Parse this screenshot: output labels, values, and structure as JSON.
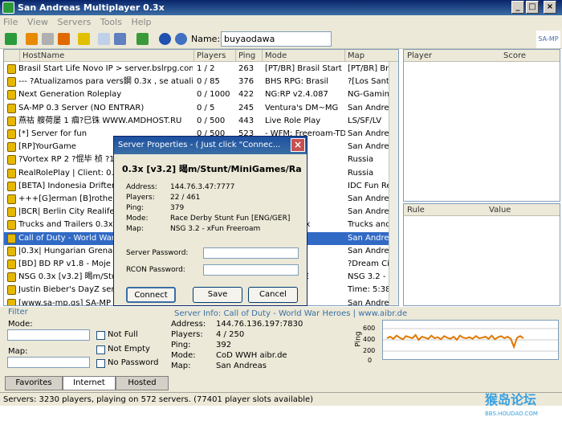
{
  "window": {
    "title": "San Andreas Multiplayer 0.3x",
    "min_label": "_",
    "max_label": "□",
    "close_label": "×"
  },
  "menu": [
    "File",
    "View",
    "Servers",
    "Tools",
    "Help"
  ],
  "toolbar": {
    "name_label": "Name:",
    "name_value": "buyaodawa"
  },
  "list_headers": [
    "HostName",
    "Players",
    "Ping",
    "Mode",
    "Map"
  ],
  "servers": [
    {
      "host": "Brasil Start Life Novo IP > server.bslrpg.com:7777",
      "players": "1 / 2",
      "ping": "263",
      "mode": "[PT/BR] Brasil Start Life | v",
      "map": "[PT/BR] Bra"
    },
    {
      "host": "--- ?Atualizamos para vers鋼 0.3x , se atualize!",
      "players": "0 / 85",
      "ping": "376",
      "mode": "BHS RPG: Brasil",
      "map": "?[Los Santo"
    },
    {
      "host": "Next Generation Roleplay",
      "players": "0 / 1000",
      "ping": "422",
      "mode": "NG:RP v2.4.087",
      "map": "NG-Gaming."
    },
    {
      "host": "SA-MP 0.3 Server (NO ENTRAR)",
      "players": "0 / 5",
      "ping": "245",
      "mode": "Ventura's DM~MG",
      "map": "San Andreas"
    },
    {
      "host": "燕祜 艘荷屡 1 痼?巳铢  WWW.AMDHOST.RU",
      "players": "0 / 500",
      "ping": "443",
      "mode": "Live Role Play",
      "map": "LS/SF/LV"
    },
    {
      "host": "[*] Server for fun",
      "players": "0 / 500",
      "ping": "523",
      "mode": "- WFM: Freeroam-TDM-S",
      "map": "San Andreas"
    },
    {
      "host": "[RP]YourGame",
      "players": "",
      "ping": "",
      "mode": "**********",
      "map": "San Andreas"
    },
    {
      "host": "?Vortex RP 2 ?惃毕   桢 ?1",
      "players": "",
      "ping": "",
      "mode": "",
      "map": "Russia"
    },
    {
      "host": "RealRolePlay | Client: 0.3x",
      "players": "",
      "ping": "",
      "mode": "",
      "map": "Russia"
    },
    {
      "host": "[BETA] Indonesia Drifter C",
      "players": "",
      "ping": "",
      "mode": "World!",
      "map": "IDC Fun Rele"
    },
    {
      "host": "+++[G]erman [B]rother[H]",
      "players": "",
      "ping": "",
      "mode": "",
      "map": "San Andreas"
    },
    {
      "host": "|BCR| Berlin City Realife |G",
      "players": "",
      "ping": "",
      "mode": "fe",
      "map": "San Andreas"
    },
    {
      "host": "Trucks and Trailers 0.3x (c",
      "players": "",
      "ping": "",
      "mode": "railers 0.3x",
      "map": "Trucks and T"
    },
    {
      "host": "Call of Duty - World War He",
      "players": "",
      "ping": "",
      "mode": "r.de",
      "map": "San Andreas"
    },
    {
      "host": "|0.3x| Hungarian Grenade W",
      "players": "",
      "ping": "",
      "mode": "e War",
      "map": "San Andreas"
    },
    {
      "host": "[BD] BD RP v1.8 - Moje kuc",
      "players": "",
      "ping": "",
      "mode": "",
      "map": "?Dream City"
    },
    {
      "host": "NSG 0.3x [v3.2]    暍m/Stu",
      "players": "",
      "ping": "",
      "mode": "tunt Fun [E",
      "map": "NSG 3.2 - xf"
    },
    {
      "host": "Justin Bieber's DayZ server",
      "players": "",
      "ping": "",
      "mode": "?v4.4",
      "map": "Time: 5:38"
    },
    {
      "host": "[www.sa-mp.gs] SA-MP 0.3",
      "players": "",
      "ping": "",
      "mode": "Batch",
      "map": "San Andreas"
    }
  ],
  "player_headers": [
    "Player",
    "Score"
  ],
  "rule_headers": [
    "Rule",
    "Value"
  ],
  "filter": {
    "title": "Filter",
    "mode_label": "Mode:",
    "map_label": "Map:",
    "not_full": "Not Full",
    "not_empty": "Not Empty",
    "no_password": "No Password"
  },
  "info": {
    "title": "Server Info: Call of Duty - World War Heroes | www.aibr.de",
    "address_label": "Address:",
    "address": "144.76.136.197:7830",
    "players_label": "Players:",
    "players": "4 / 250",
    "ping_label": "Ping:",
    "ping": "392",
    "mode_label": "Mode:",
    "mode": "CoD WWH aibr.de",
    "map_label": "Map:",
    "map": "San Andreas"
  },
  "graph": {
    "axis_label": "Ping",
    "ticks": [
      "600",
      "400",
      "200",
      "0"
    ],
    "ping_series": [
      390,
      420,
      380,
      440,
      400,
      370,
      430,
      410,
      390,
      450,
      360,
      420,
      400,
      380,
      440,
      390,
      410,
      370,
      430,
      400,
      380,
      420,
      360,
      440,
      400,
      390,
      410,
      380,
      430,
      390,
      400,
      420,
      380,
      440,
      370,
      410,
      430,
      390,
      420,
      380,
      230,
      400,
      430,
      390
    ],
    "color": "#e07800"
  },
  "tabs": [
    "Favorites",
    "Internet",
    "Hosted"
  ],
  "status": "Servers: 3230 players, playing on 572 servers. (77401 player slots available)",
  "watermark": {
    "main": "猴岛论坛",
    "sub": "BBS.HOUDAO.COM"
  },
  "dialog": {
    "title": "Server Properties - ( Just click \"Connec...",
    "close": "×",
    "server_name": "0.3x [v3.2]     暍m/Stunt/MiniGames/Ra",
    "address_label": "Address:",
    "address": "144.76.3.47:7777",
    "players_label": "Players:",
    "players": "22 / 461",
    "ping_label": "Ping:",
    "ping": "379",
    "mode_label": "Mode:",
    "mode": "Race Derby Stunt Fun [ENG/GER]",
    "map_label": "Map:",
    "map": "NSG 3.2 - xFun Freeroam",
    "server_password_label": "Server Password:",
    "rcon_password_label": "RCON Password:",
    "connect": "Connect",
    "save": "Save",
    "cancel": "Cancel"
  }
}
